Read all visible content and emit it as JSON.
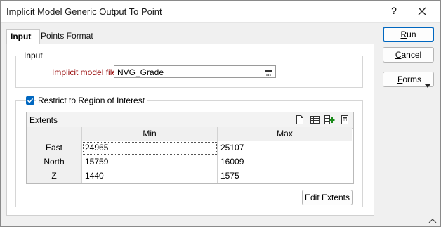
{
  "window": {
    "title": "Implicit Model Generic Output To Point",
    "help_label": "?",
    "close_icon": "close-icon"
  },
  "tabs": [
    {
      "label": "Input",
      "active": true
    },
    {
      "label": "Points Format",
      "active": false
    }
  ],
  "input_group": {
    "title": "Input",
    "implicit_model_label": "Implicit model file",
    "implicit_model_value": "NVG_Grade",
    "browse_icon": "ellipsis-browse-icon"
  },
  "region": {
    "checkbox_label": "Restrict to Region of Interest",
    "checked": true,
    "extents_title": "Extents",
    "toolbar_icons": [
      "new-file-icon",
      "table-icon",
      "add-row-icon",
      "calculator-icon"
    ],
    "columns": [
      "",
      "Min",
      "Max"
    ],
    "rows": [
      {
        "name": "East",
        "min": "24965",
        "max": "25107"
      },
      {
        "name": "North",
        "min": "15759",
        "max": "16009"
      },
      {
        "name": "Z",
        "min": "1440",
        "max": "1575"
      }
    ],
    "edit_extents_label": "Edit Extents"
  },
  "side_buttons": {
    "run_prefix": "",
    "run_u": "R",
    "run_rest": "un",
    "cancel_u": "C",
    "cancel_rest": "ancel",
    "forms_u": "F",
    "forms_rest": "orms",
    "dropdown_icon": "dropdown-arrow-icon"
  },
  "colors": {
    "accent": "#0067c0",
    "label_red": "#9b1010"
  }
}
